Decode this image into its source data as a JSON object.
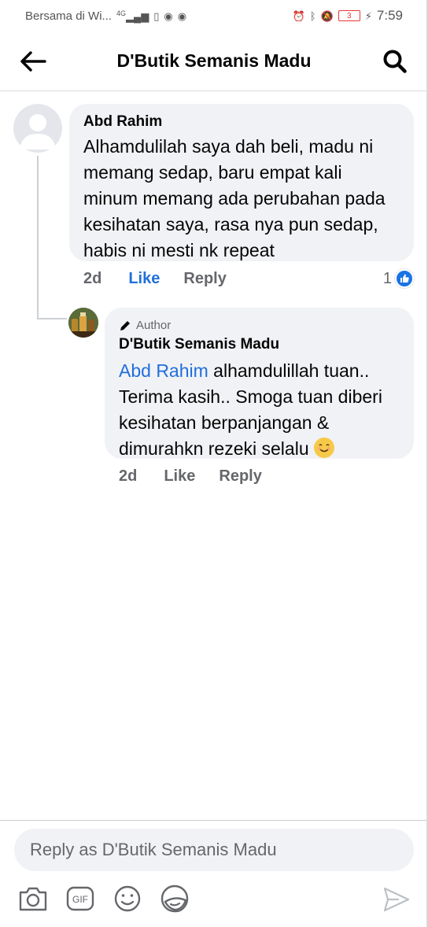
{
  "status_bar": {
    "carrier": "Bersama di Wi...",
    "signal_tag": "4G",
    "battery_level": "3",
    "time": "7:59"
  },
  "header": {
    "title": "D'Butik Semanis Madu"
  },
  "comment": {
    "author": "Abd Rahim",
    "text": "Alhamdulilah saya dah beli, madu ni memang sedap, baru empat kali minum memang ada perubahan pada kesihatan saya, rasa nya pun sedap, habis ni mesti nk repeat",
    "time": "2d",
    "like_label": "Like",
    "reply_label": "Reply",
    "reaction_count": "1"
  },
  "reply": {
    "badge": "Author",
    "author": "D'Butik Semanis Madu",
    "mention": "Abd Rahim",
    "text": " alhamdulillah tuan.. Terima kasih.. Smoga tuan diberi kesihatan berpanjangan & dimurahkn rezeki selalu ",
    "time": "2d",
    "like_label": "Like",
    "reply_label": "Reply"
  },
  "composer": {
    "placeholder": "Reply as D'Butik Semanis Madu",
    "tools": [
      "camera-icon",
      "gif-icon",
      "emoji-icon",
      "sticker-icon"
    ],
    "send": "send-icon",
    "gif_label": "GIF"
  },
  "colors": {
    "accent": "#216fdb",
    "bubble": "#f0f2f5",
    "secondary_text": "#65676b"
  }
}
